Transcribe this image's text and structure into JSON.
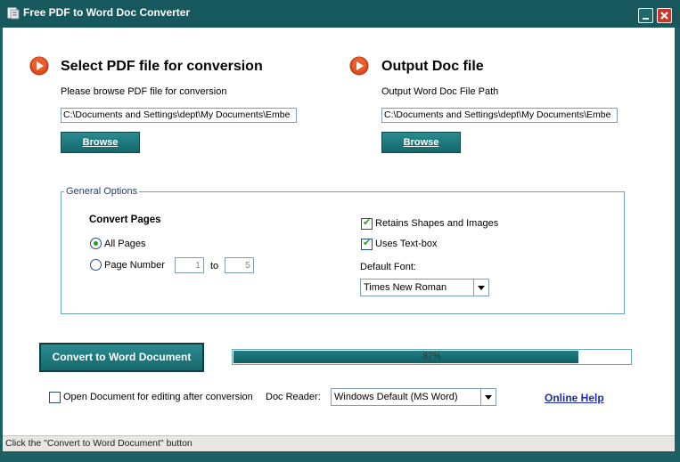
{
  "window": {
    "title": "Free PDF to Word Doc Converter",
    "icon": "app-icon",
    "minimize_icon": "minimize-icon",
    "close_icon": "close-icon"
  },
  "input_section": {
    "heading": "Select PDF file for conversion",
    "hint": "Please browse PDF file for conversion",
    "path": "C:\\Documents and Settings\\dept\\My Documents\\Embe",
    "browse_label": "Browse",
    "icon": "play-arrow-icon"
  },
  "output_section": {
    "heading": "Output Doc file",
    "hint": "Output Word Doc File Path",
    "path": "C:\\Documents and Settings\\dept\\My Documents\\Embe",
    "browse_label": "Browse",
    "icon": "play-arrow-icon"
  },
  "options": {
    "legend": "General Options",
    "convert_pages_label": "Convert Pages",
    "all_pages_label": "All Pages",
    "all_pages_selected": true,
    "page_number_label": "Page Number",
    "page_from": "1",
    "to_label": "to",
    "page_to": "5",
    "retain_shapes_label": "Retains Shapes and Images",
    "retain_shapes_checked": true,
    "uses_textbox_label": "Uses Text-box",
    "uses_textbox_checked": true,
    "default_font_label": "Default Font:",
    "default_font_value": "Times New Roman"
  },
  "actions": {
    "convert_label": "Convert to Word Document",
    "progress_text": "87%",
    "progress_value": 0.87,
    "open_after_label": "Open Document for editing after conversion",
    "open_after_checked": false,
    "doc_reader_label": "Doc Reader:",
    "doc_reader_value": "Windows Default (MS Word)",
    "online_help_label": "Online Help"
  },
  "status_bar": {
    "text": "Click the \"Convert to Word Document\" button"
  },
  "colors": {
    "accent": "#17585c",
    "button": "#1f7e83",
    "link": "#1a2bb0",
    "checkmark": "#21a121"
  }
}
